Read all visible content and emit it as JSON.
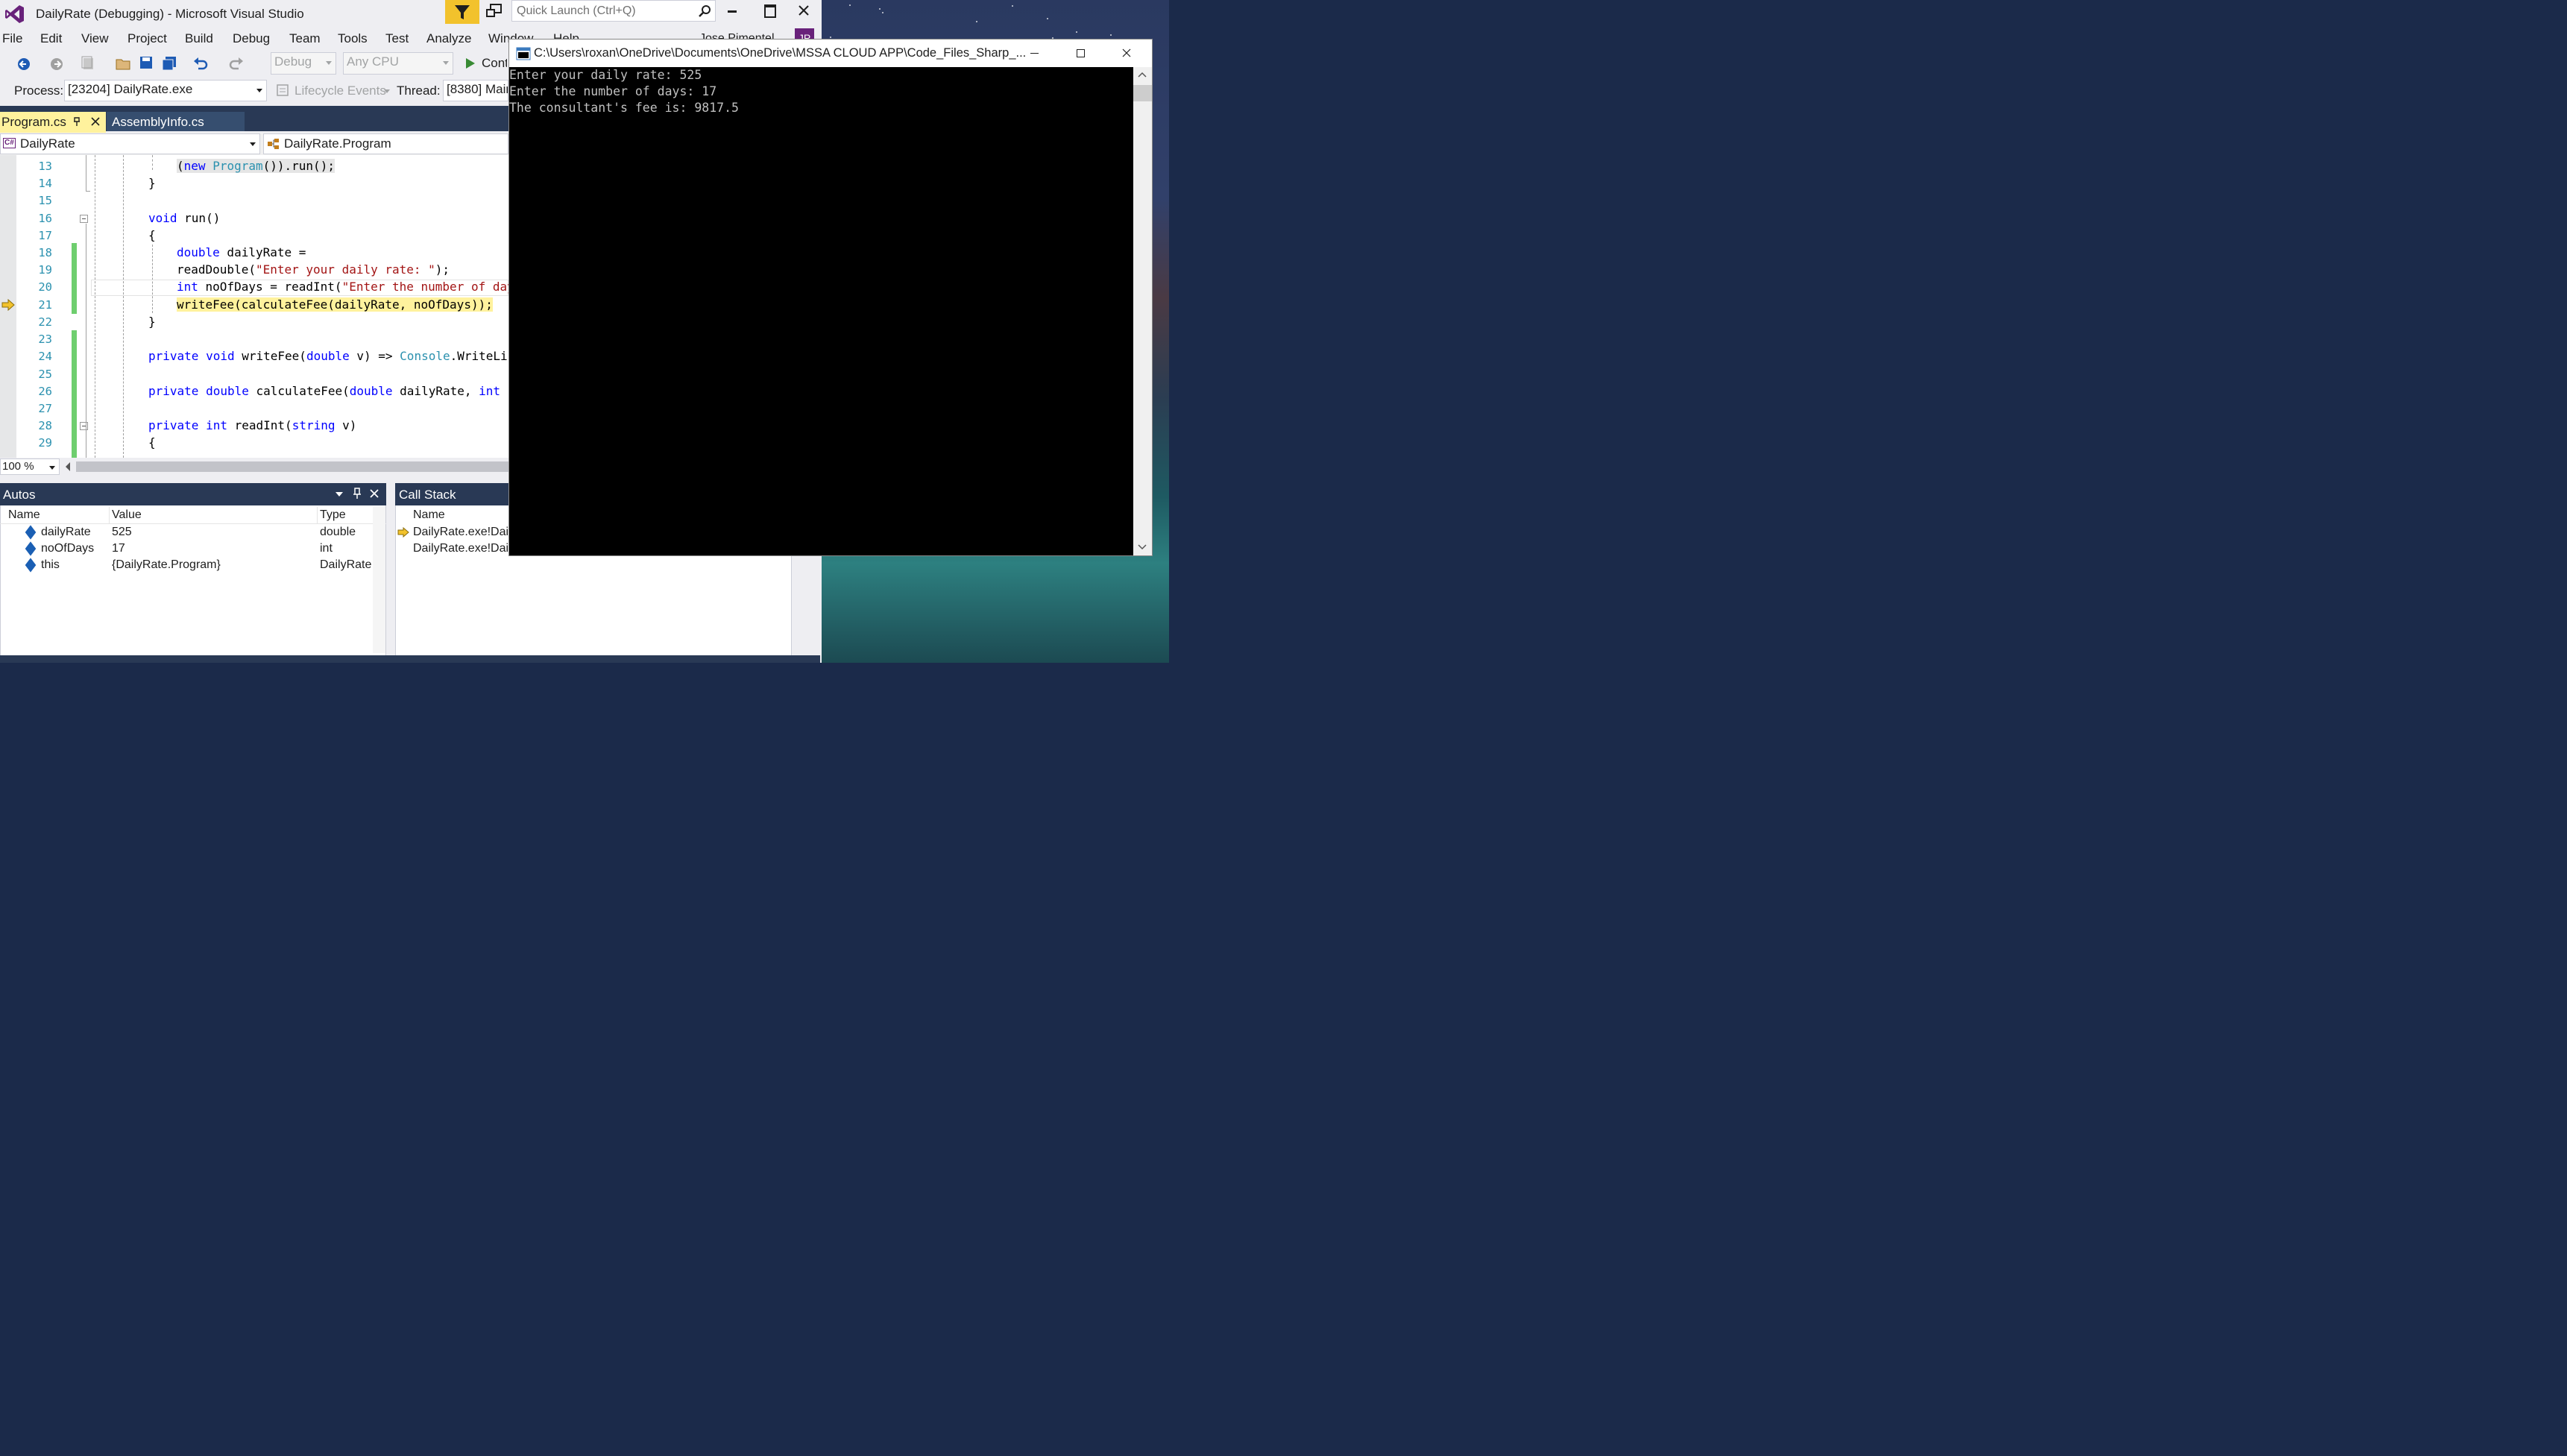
{
  "vs": {
    "title": "DailyRate (Debugging) - Microsoft Visual Studio",
    "quick_launch_placeholder": "Quick Launch (Ctrl+Q)",
    "menu": [
      "File",
      "Edit",
      "View",
      "Project",
      "Build",
      "Debug",
      "Team",
      "Tools",
      "Test",
      "Analyze",
      "Window",
      "Help"
    ],
    "user_name": "Jose Pimentel",
    "user_initials": "JP",
    "toolbar": {
      "config": "Debug",
      "platform": "Any CPU",
      "continue_label": "Continue"
    },
    "toolbar2": {
      "process_label": "Process:",
      "process_value": "[23204] DailyRate.exe",
      "lifecycle_label": "Lifecycle Events",
      "thread_label": "Thread:",
      "thread_value": "[8380] Main Thread"
    },
    "tabs": [
      {
        "label": "Program.cs"
      },
      {
        "label": "AssemblyInfo.cs"
      }
    ],
    "nav": {
      "project": "DailyRate",
      "class": "DailyRate.Program"
    },
    "editor": {
      "line_numbers": [
        "13",
        "14",
        "15",
        "16",
        "17",
        "18",
        "19",
        "20",
        "21",
        "22",
        "23",
        "24",
        "25",
        "26",
        "27",
        "28",
        "29"
      ],
      "zoom": "100 %"
    },
    "autos": {
      "title": "Autos",
      "columns": [
        "Name",
        "Value",
        "Type"
      ],
      "rows": [
        {
          "name": "dailyRate",
          "value": "525",
          "type": "double"
        },
        {
          "name": "noOfDays",
          "value": "17",
          "type": "int"
        },
        {
          "name": "this",
          "value": "{DailyRate.Program}",
          "type": "DailyRate"
        }
      ]
    },
    "callstack": {
      "title": "Call Stack",
      "columns": [
        "Name"
      ],
      "rows": [
        "DailyRate.exe!DailyRate.Program.run()",
        "DailyRate.exe!DailyRate.Program.Main(string[] args)"
      ]
    }
  },
  "console": {
    "title": "C:\\Users\\roxan\\OneDrive\\Documents\\OneDrive\\MSSA  CLOUD APP\\Code_Files_Sharp_...",
    "lines": [
      "Enter your daily rate: 525",
      "Enter the number of days: 17",
      "The consultant's fee is: 9817.5"
    ]
  },
  "colors": {
    "vs_accent": "#68217a",
    "tab_active": "#fff29d",
    "tab_bar": "#293955",
    "change_bar": "#6ece6e",
    "breakpoint_arrow": "#f2c22c"
  }
}
